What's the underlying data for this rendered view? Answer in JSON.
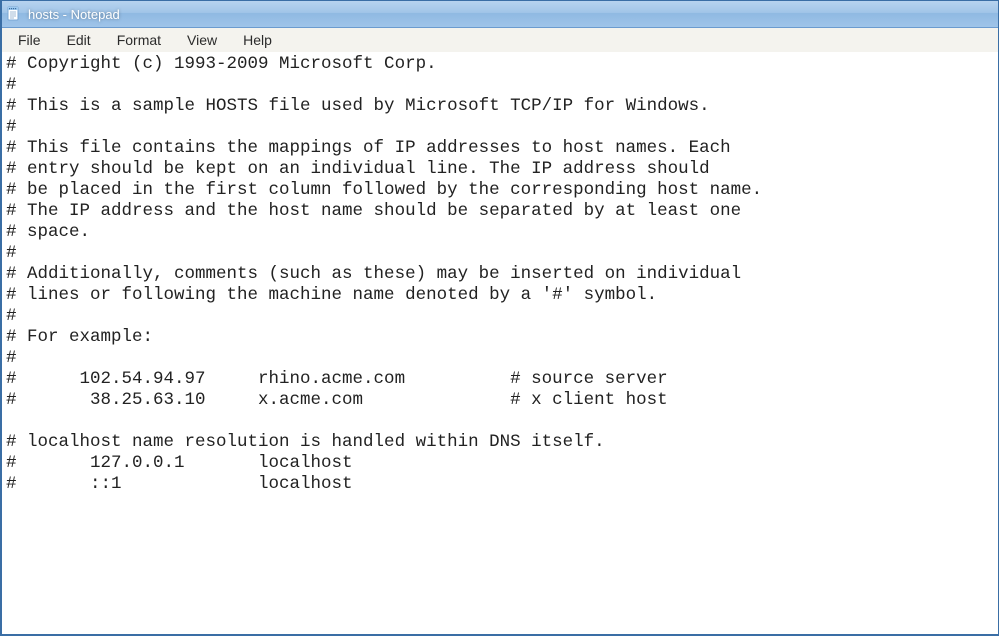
{
  "window": {
    "title": "hosts - Notepad"
  },
  "menu": {
    "items": [
      "File",
      "Edit",
      "Format",
      "View",
      "Help"
    ]
  },
  "editor": {
    "content": "# Copyright (c) 1993-2009 Microsoft Corp.\n#\n# This is a sample HOSTS file used by Microsoft TCP/IP for Windows.\n#\n# This file contains the mappings of IP addresses to host names. Each\n# entry should be kept on an individual line. The IP address should\n# be placed in the first column followed by the corresponding host name.\n# The IP address and the host name should be separated by at least one\n# space.\n#\n# Additionally, comments (such as these) may be inserted on individual\n# lines or following the machine name denoted by a '#' symbol.\n#\n# For example:\n#\n#      102.54.94.97     rhino.acme.com          # source server\n#       38.25.63.10     x.acme.com              # x client host\n\n# localhost name resolution is handled within DNS itself.\n#       127.0.0.1       localhost\n#       ::1             localhost\n"
  }
}
